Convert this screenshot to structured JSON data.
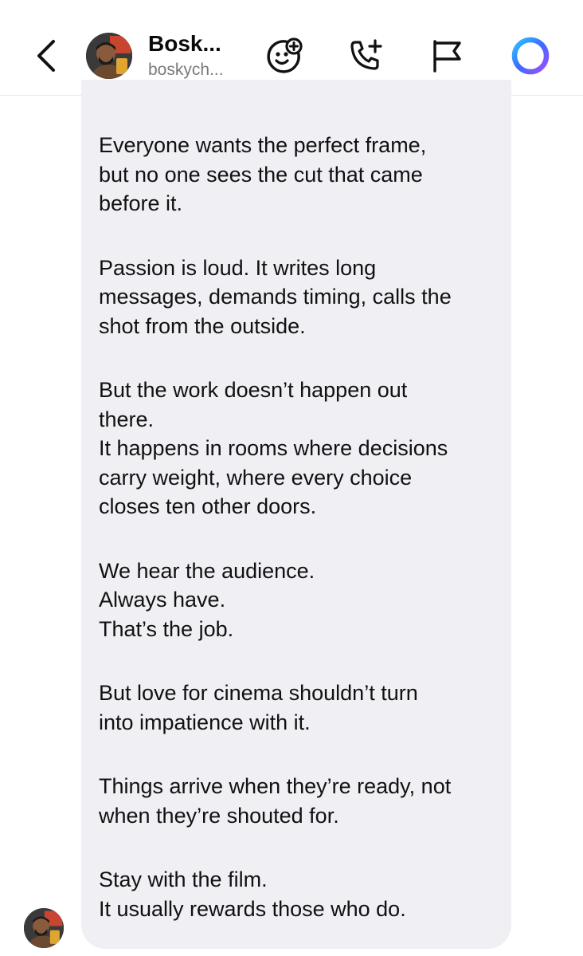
{
  "header": {
    "display_name": "Bosk...",
    "username": "boskych...",
    "icons": [
      "back-chevron-icon",
      "avatar",
      "sticker-add-icon",
      "call-add-icon",
      "flag-icon",
      "ai-ring-icon"
    ],
    "accent_ring_colors": [
      "#3b6bff",
      "#7b4dff",
      "#2ec4ff"
    ]
  },
  "message": {
    "paragraphs": [
      [
        "Everyone wants the perfect frame,",
        "but no one sees the cut that came",
        "before it."
      ],
      [
        "Passion is loud. It writes long",
        "messages, demands timing, calls the",
        "shot from the outside."
      ],
      [
        "But the work doesn’t happen out",
        "there.",
        "It happens in rooms where decisions",
        "carry weight, where every choice",
        "closes ten other doors."
      ],
      [
        "We hear the audience.",
        "Always have.",
        "That’s the job."
      ],
      [
        "But love for cinema shouldn’t turn",
        "into impatience with it."
      ],
      [
        "Things arrive when they’re ready, not",
        "when they’re shouted for."
      ],
      [
        "Stay with the film.",
        "It usually rewards those who do."
      ]
    ]
  }
}
